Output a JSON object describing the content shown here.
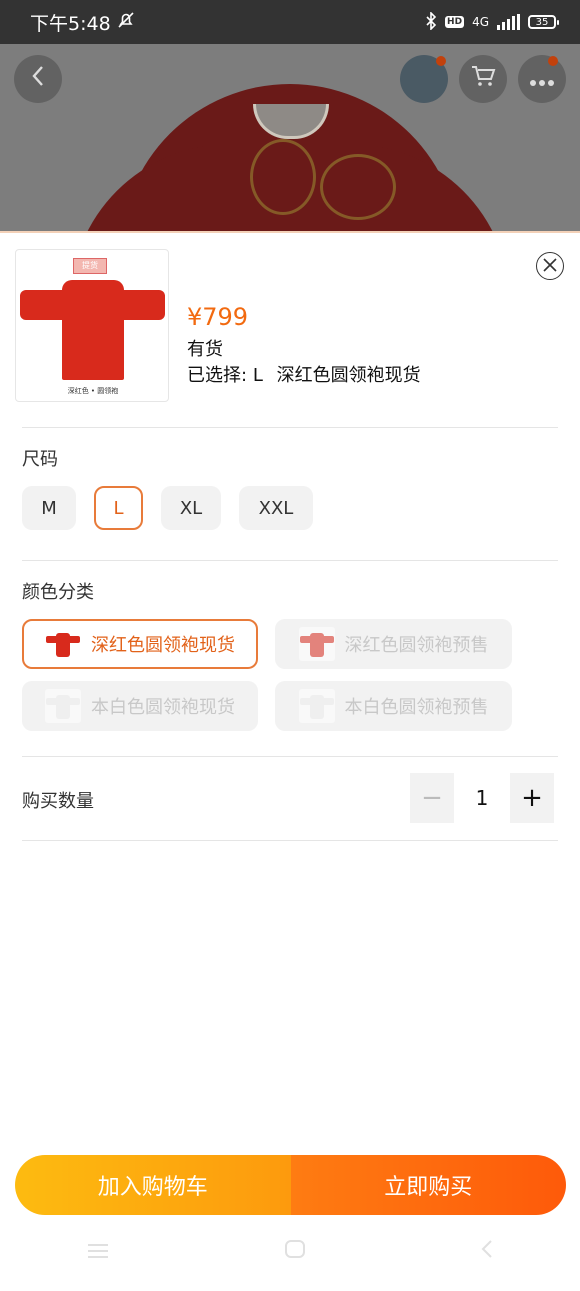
{
  "status_bar": {
    "time": "下午5:48",
    "network": "4G",
    "battery": "35"
  },
  "product": {
    "price": "¥799",
    "stock": "有货",
    "selected_label": "已选择:",
    "selected_size": "L",
    "selected_color": "深红色圆领袍现货",
    "thumb_tag": "提货",
    "thumb_caption": "深红色 • 圆领袍"
  },
  "size": {
    "title": "尺码",
    "options": [
      "M",
      "L",
      "XL",
      "XXL"
    ],
    "selected": "L"
  },
  "color": {
    "title": "颜色分类",
    "options": [
      "深红色圆领袍现货",
      "深红色圆领袍预售",
      "本白色圆领袍现货",
      "本白色圆领袍预售"
    ],
    "selected": "深红色圆领袍现货"
  },
  "quantity": {
    "title": "购买数量",
    "value": "1",
    "minus": "−",
    "plus": "+"
  },
  "actions": {
    "add_to_cart": "加入购物车",
    "buy_now": "立即购买"
  },
  "icons": {
    "back": "chevron-left-icon",
    "cart": "cart-icon",
    "more": "more-icon",
    "close": "close-icon"
  },
  "colors": {
    "accent": "#f26a10",
    "cart_button": "#fdaa10",
    "buy_button": "#fe6a0e"
  }
}
